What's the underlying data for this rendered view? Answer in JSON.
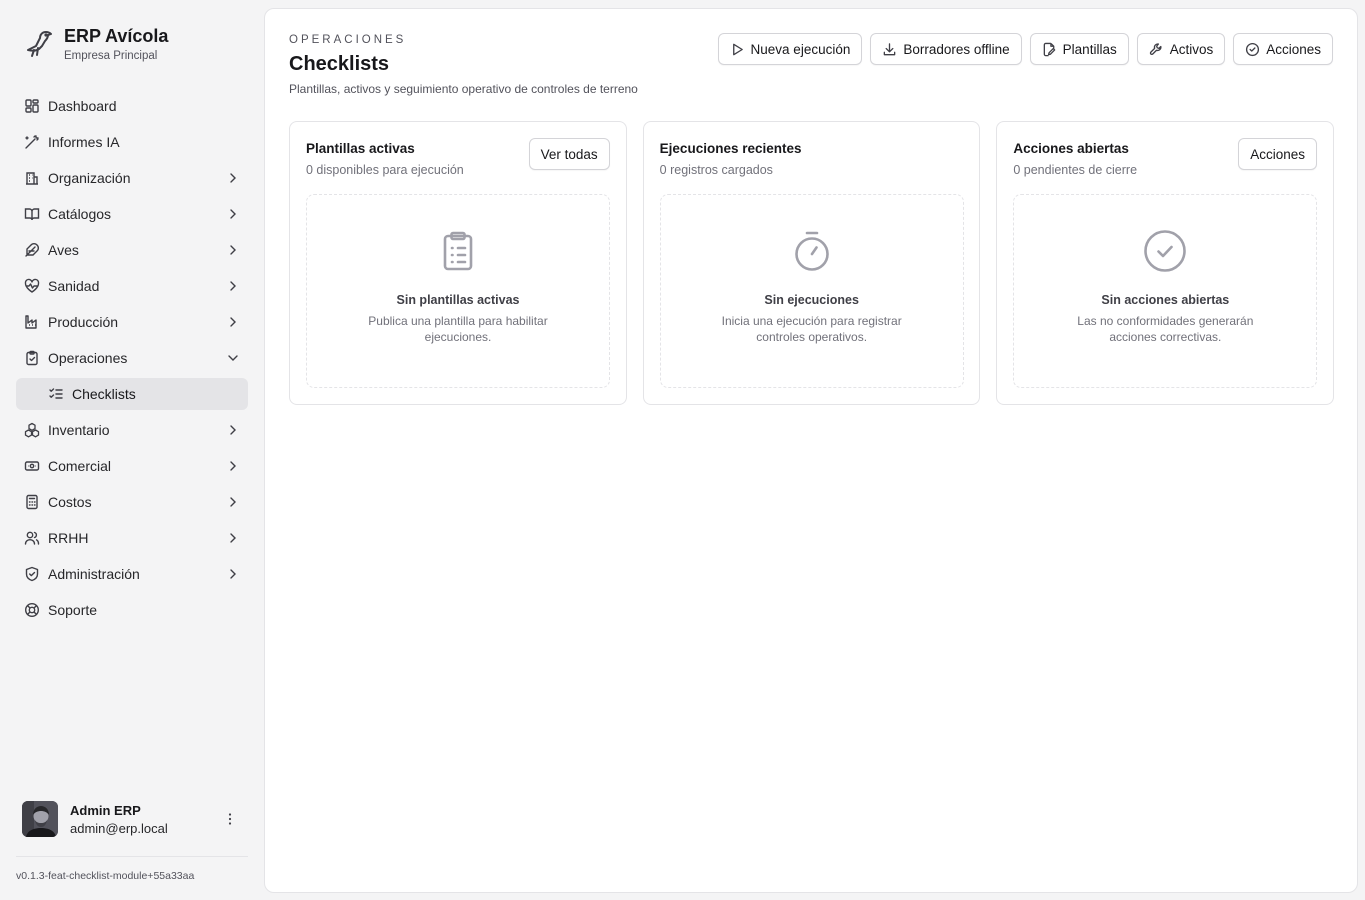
{
  "brand": {
    "title": "ERP Avícola",
    "subtitle": "Empresa Principal"
  },
  "sidebar": {
    "items": [
      {
        "label": "Dashboard",
        "icon": "layout-dashboard-icon",
        "expandable": false
      },
      {
        "label": "Informes IA",
        "icon": "magic-wand-icon",
        "expandable": false
      },
      {
        "label": "Organización",
        "icon": "building-icon",
        "expandable": true
      },
      {
        "label": "Catálogos",
        "icon": "book-open-icon",
        "expandable": true
      },
      {
        "label": "Aves",
        "icon": "feather-icon",
        "expandable": true
      },
      {
        "label": "Sanidad",
        "icon": "heart-pulse-icon",
        "expandable": true
      },
      {
        "label": "Producción",
        "icon": "factory-icon",
        "expandable": true
      },
      {
        "label": "Operaciones",
        "icon": "clipboard-check-icon",
        "expandable": true,
        "expanded": true
      },
      {
        "label": "Checklists",
        "icon": "list-checks-icon",
        "active": true
      },
      {
        "label": "Inventario",
        "icon": "boxes-icon",
        "expandable": true
      },
      {
        "label": "Comercial",
        "icon": "banknote-icon",
        "expandable": true
      },
      {
        "label": "Costos",
        "icon": "calculator-icon",
        "expandable": true
      },
      {
        "label": "RRHH",
        "icon": "users-icon",
        "expandable": true
      },
      {
        "label": "Administración",
        "icon": "shield-check-icon",
        "expandable": true
      },
      {
        "label": "Soporte",
        "icon": "life-buoy-icon",
        "expandable": false
      }
    ]
  },
  "user": {
    "name": "Admin ERP",
    "email": "admin@erp.local"
  },
  "version": "v0.1.3-feat-checklist-module+55a33aa",
  "header": {
    "eyebrow": "OPERACIONES",
    "title": "Checklists",
    "description": "Plantillas, activos y seguimiento operativo de controles de terreno"
  },
  "toolbar": {
    "new_run": "Nueva ejecución",
    "offline_drafts": "Borradores offline",
    "templates": "Plantillas",
    "assets": "Activos",
    "actions": "Acciones"
  },
  "cards": [
    {
      "title": "Plantillas activas",
      "subtitle": "0 disponibles para ejecución",
      "button": "Ver todas",
      "empty_title": "Sin plantillas activas",
      "empty_desc": "Publica una plantilla para habilitar ejecuciones."
    },
    {
      "title": "Ejecuciones recientes",
      "subtitle": "0 registros cargados",
      "empty_title": "Sin ejecuciones",
      "empty_desc": "Inicia una ejecución para registrar controles operativos."
    },
    {
      "title": "Acciones abiertas",
      "subtitle": "0 pendientes de cierre",
      "button": "Acciones",
      "empty_title": "Sin acciones abiertas",
      "empty_desc": "Las no conformidades generarán acciones correctivas."
    }
  ],
  "colors": {
    "background": "#f4f4f5",
    "panel": "#ffffff",
    "active_item": "#e4e4e7",
    "border": "#e4e4e7",
    "text": "#18181b",
    "muted": "#71717a"
  }
}
